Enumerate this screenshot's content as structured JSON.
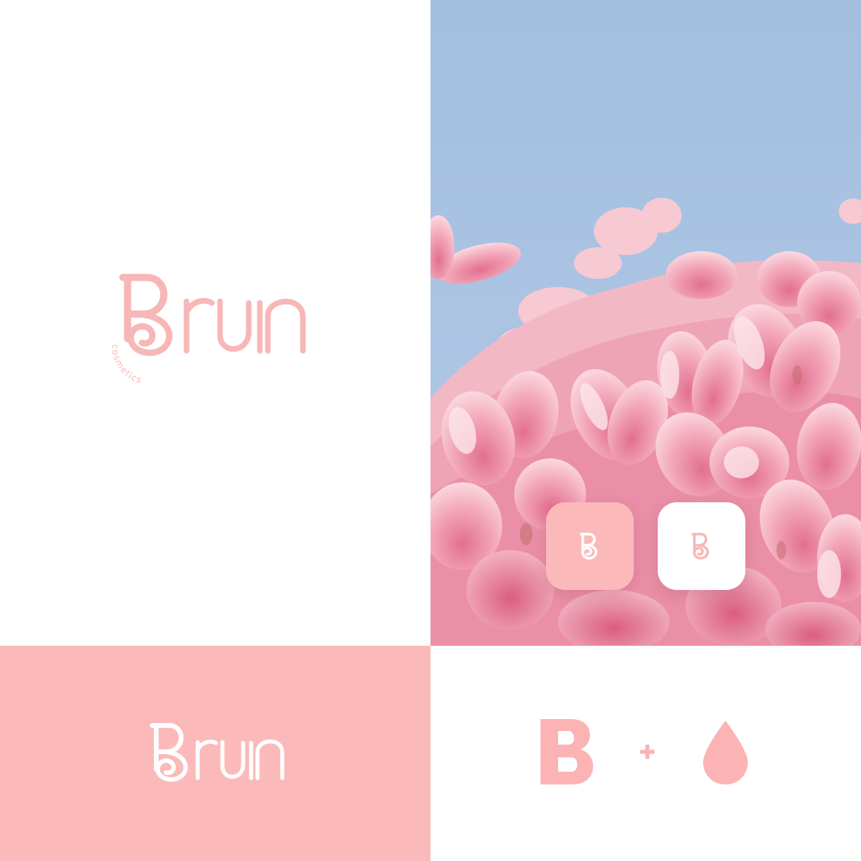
{
  "brand": {
    "name": "Brun",
    "tagline": "cosmetics"
  },
  "colors": {
    "brand_pink": "#fbbab9",
    "logo_pink": "#f7b7b7",
    "sky_blue": "#a6c2e0",
    "white": "#ffffff"
  },
  "icons": {
    "app_icon_pink": "b-monogram-icon",
    "app_icon_white": "b-monogram-icon",
    "concept_letter": "letter-b-icon",
    "concept_plus": "plus-icon",
    "concept_drop": "water-drop-icon"
  }
}
